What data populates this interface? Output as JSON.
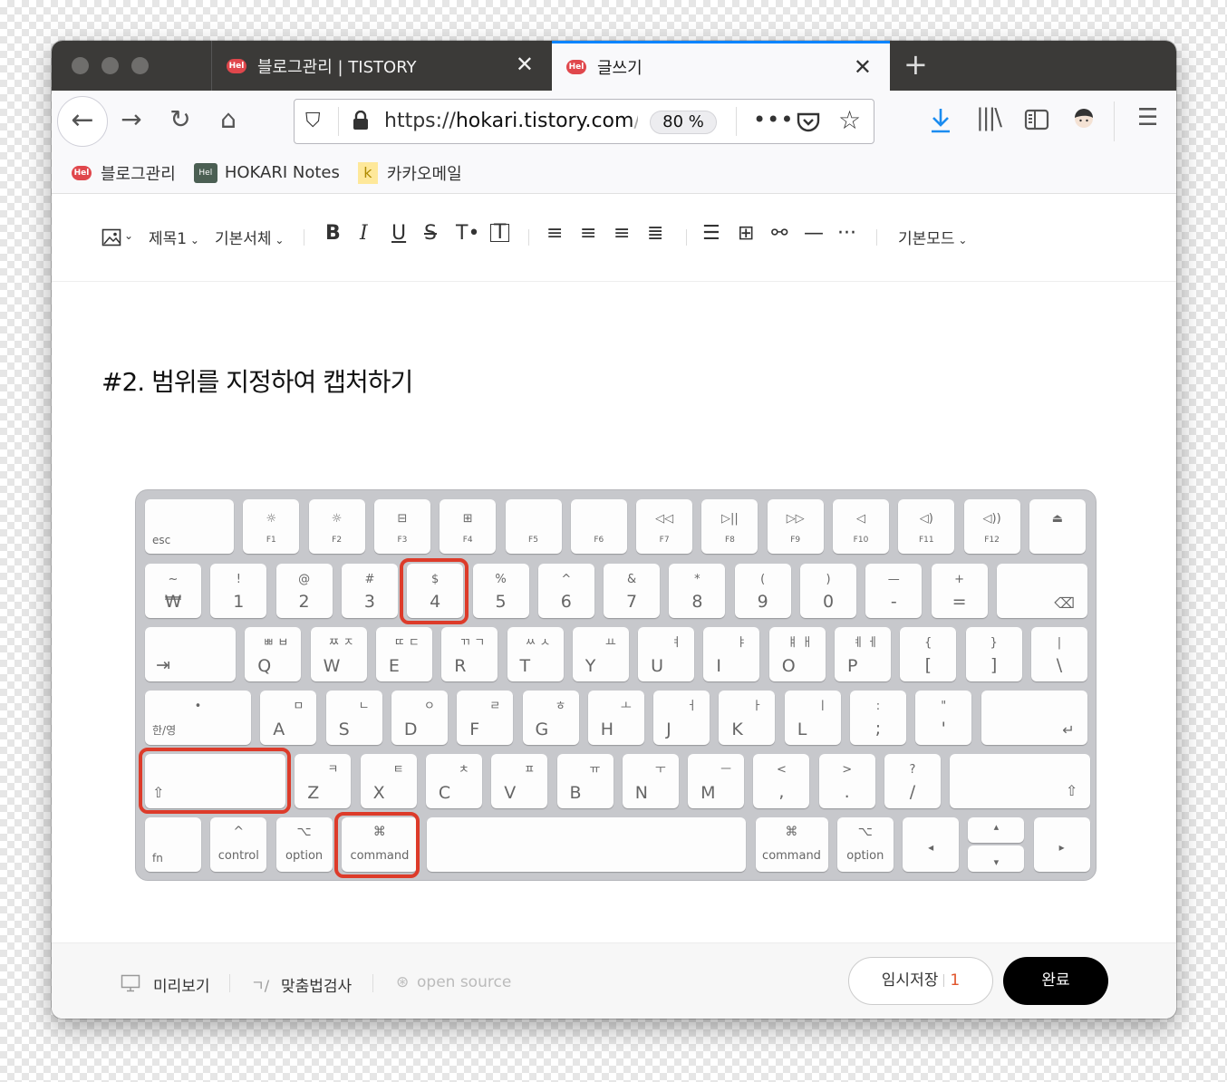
{
  "tabs": [
    {
      "label": "블로그관리 | TISTORY",
      "favicon": "Hel"
    },
    {
      "label": "글쓰기",
      "favicon": "Hel"
    }
  ],
  "toolbar": {
    "url_scheme": "https://",
    "url_host": "hokari.tistory.com",
    "url_rest": "/m",
    "zoom": "80 %"
  },
  "bookmarks": [
    {
      "label": "블로그관리",
      "icon": "Hel"
    },
    {
      "label": "HOKARI Notes",
      "icon": "Hel"
    },
    {
      "label": "카카오메일",
      "icon": "k"
    }
  ],
  "editor_toolbar": {
    "heading_select": "제목1",
    "font_select": "기본서체",
    "mode_select": "기본모드"
  },
  "content": {
    "heading": "#2. 범위를 지정하여 캡처하기"
  },
  "keyboard": {
    "row0": [
      {
        "bot": "esc"
      },
      {
        "icon": "☼",
        "lbl": "F1"
      },
      {
        "icon": "☼",
        "lbl": "F2"
      },
      {
        "icon": "⊟",
        "lbl": "F3"
      },
      {
        "icon": "⊞",
        "lbl": "F4"
      },
      {
        "icon": "",
        "lbl": "F5"
      },
      {
        "icon": "",
        "lbl": "F6"
      },
      {
        "icon": "◁◁",
        "lbl": "F7"
      },
      {
        "icon": "▷||",
        "lbl": "F8"
      },
      {
        "icon": "▷▷",
        "lbl": "F9"
      },
      {
        "icon": "◁",
        "lbl": "F10"
      },
      {
        "icon": "◁)",
        "lbl": "F11"
      },
      {
        "icon": "◁))",
        "lbl": "F12"
      },
      {
        "icon": "⏏",
        "lbl": ""
      }
    ],
    "row1": [
      {
        "top": "~",
        "bot": "₩"
      },
      {
        "top": "!",
        "bot": "1"
      },
      {
        "top": "@",
        "bot": "2"
      },
      {
        "top": "#",
        "bot": "3"
      },
      {
        "top": "$",
        "bot": "4"
      },
      {
        "top": "%",
        "bot": "5"
      },
      {
        "top": "^",
        "bot": "6"
      },
      {
        "top": "&",
        "bot": "7"
      },
      {
        "top": "*",
        "bot": "8"
      },
      {
        "top": "(",
        "bot": "9"
      },
      {
        "top": ")",
        "bot": "0"
      },
      {
        "top": "—",
        "bot": "-"
      },
      {
        "top": "+",
        "bot": "="
      },
      {
        "top": "",
        "bot": "⌫"
      }
    ],
    "row2": [
      {
        "top": "",
        "bot": "⇥"
      },
      {
        "kor": "ㅃ  ㅂ",
        "bot": "Q"
      },
      {
        "kor": "ㅉ  ㅈ",
        "bot": "W"
      },
      {
        "kor": "ㄸ  ㄷ",
        "bot": "E"
      },
      {
        "kor": "ㄲ  ㄱ",
        "bot": "R"
      },
      {
        "kor": "ㅆ  ㅅ",
        "bot": "T"
      },
      {
        "kor": "ㅛ",
        "bot": "Y"
      },
      {
        "kor": "ㅕ",
        "bot": "U"
      },
      {
        "kor": "ㅑ",
        "bot": "I"
      },
      {
        "kor": "ㅒ  ㅐ",
        "bot": "O"
      },
      {
        "kor": "ㅖ  ㅔ",
        "bot": "P"
      },
      {
        "top": "{",
        "bot": "["
      },
      {
        "top": "}",
        "bot": "]"
      },
      {
        "top": "|",
        "bot": "\\"
      }
    ],
    "row3": [
      {
        "top": "•",
        "bot": "한/영"
      },
      {
        "kor": "ㅁ",
        "bot": "A"
      },
      {
        "kor": "ㄴ",
        "bot": "S"
      },
      {
        "kor": "ㅇ",
        "bot": "D"
      },
      {
        "kor": "ㄹ",
        "bot": "F"
      },
      {
        "kor": "ㅎ",
        "bot": "G"
      },
      {
        "kor": "ㅗ",
        "bot": "H"
      },
      {
        "kor": "ㅓ",
        "bot": "J"
      },
      {
        "kor": "ㅏ",
        "bot": "K"
      },
      {
        "kor": "ㅣ",
        "bot": "L"
      },
      {
        "top": ":",
        "bot": ";"
      },
      {
        "top": "\"",
        "bot": "'"
      },
      {
        "top": "",
        "bot": "↵"
      }
    ],
    "row4": [
      {
        "bot": "⇧"
      },
      {
        "kor": "ㅋ",
        "bot": "Z"
      },
      {
        "kor": "ㅌ",
        "bot": "X"
      },
      {
        "kor": "ㅊ",
        "bot": "C"
      },
      {
        "kor": "ㅍ",
        "bot": "V"
      },
      {
        "kor": "ㅠ",
        "bot": "B"
      },
      {
        "kor": "ㅜ",
        "bot": "N"
      },
      {
        "kor": "ㅡ",
        "bot": "M"
      },
      {
        "top": "<",
        "bot": ","
      },
      {
        "top": ">",
        "bot": "."
      },
      {
        "top": "?",
        "bot": "/"
      },
      {
        "bot": "⇧"
      }
    ],
    "row5": [
      {
        "bot": "fn"
      },
      {
        "top": "^",
        "bot": "control"
      },
      {
        "top": "⌥",
        "bot": "option"
      },
      {
        "top": "⌘",
        "bot": "command"
      },
      {
        "bot": ""
      },
      {
        "top": "⌘",
        "bot": "command"
      },
      {
        "top": "⌥",
        "bot": "option"
      },
      {
        "bot": "◂"
      },
      {
        "top": "▴",
        "bot": "▾"
      },
      {
        "bot": "▸"
      }
    ]
  },
  "footer": {
    "preview": "미리보기",
    "spellcheck": "맞춤법검사",
    "opensource": "open source",
    "draft_label": "임시저장",
    "draft_count": "1",
    "done": "완료"
  },
  "colors": {
    "highlight": "#dd3b2a",
    "accent": "#0a84ff",
    "draft_count": "#e0542a"
  }
}
